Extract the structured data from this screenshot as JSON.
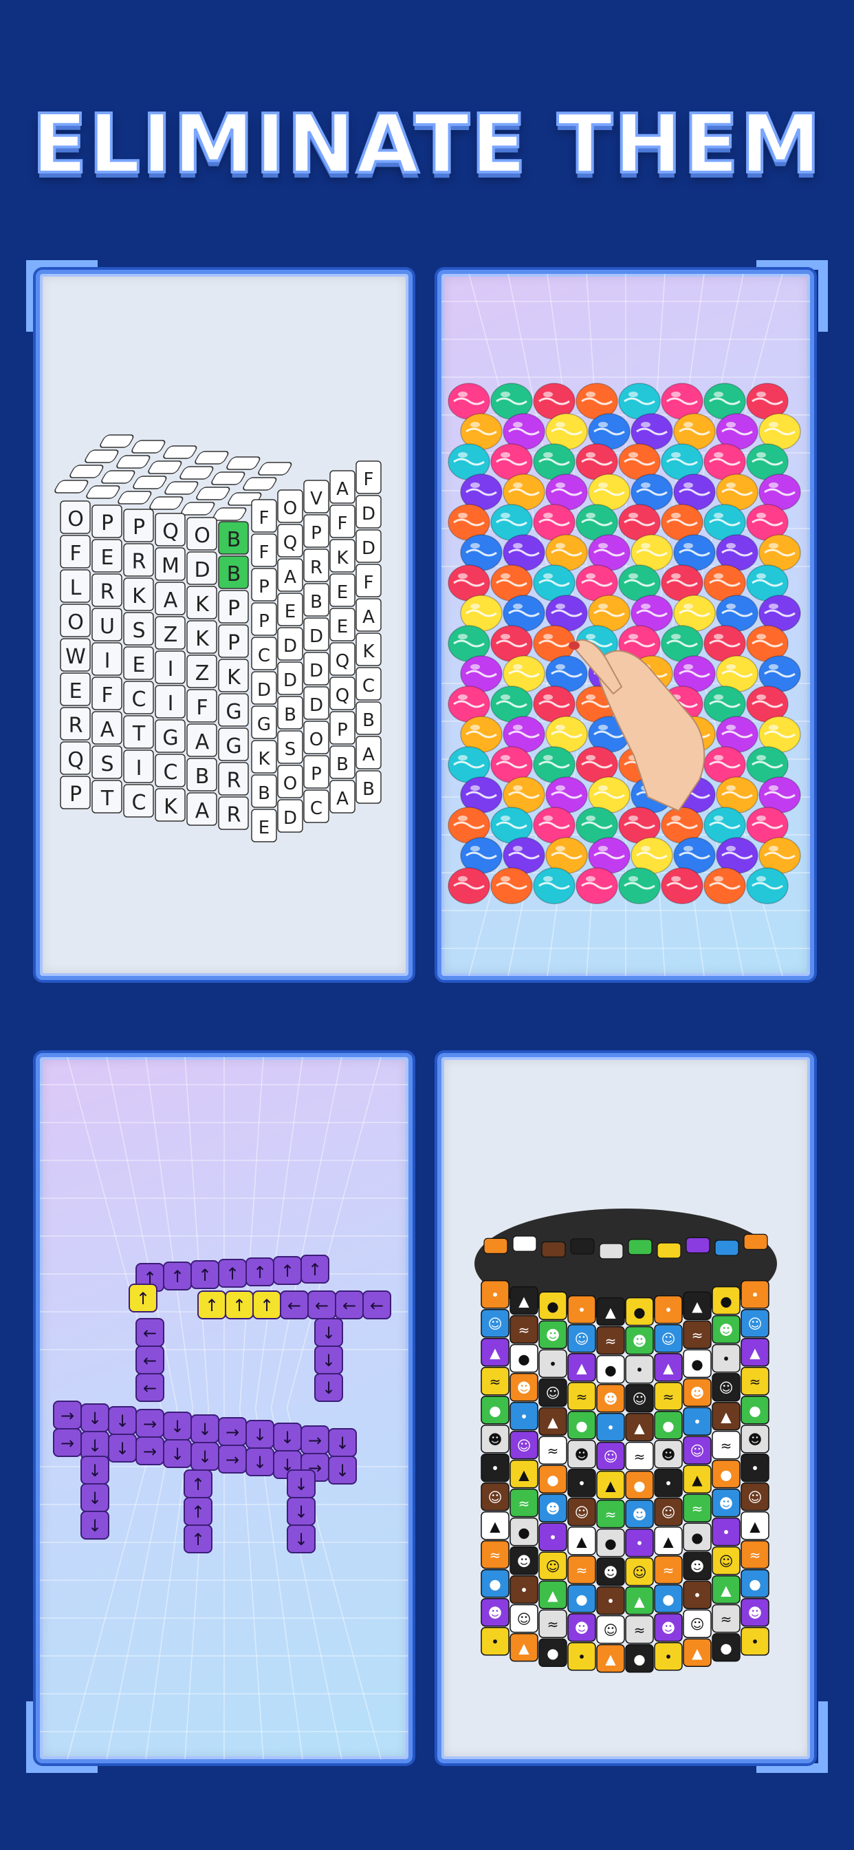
{
  "title": "ELIMINATE THEM",
  "colors": {
    "background": "#0f2f80",
    "panel_border": "#5a8df0",
    "letter_highlight": "#3cc85a",
    "block_purple": "#8a4fd8",
    "arrow_yellow": "#f5e22a"
  },
  "panels": [
    {
      "id": "letter-cube",
      "icon": "letter-cube-puzzle",
      "front_rows": [
        [
          "O",
          "P",
          "P",
          "Q",
          "O",
          "B"
        ],
        [
          "F",
          "E",
          "R",
          "M",
          "D",
          "B"
        ],
        [
          "L",
          "R",
          "K",
          "A",
          "K",
          "P"
        ],
        [
          "O",
          "U",
          "S",
          "Z",
          "K",
          "P"
        ],
        [
          "W",
          "I",
          "E",
          "I",
          "Z",
          "K"
        ],
        [
          "E",
          "F",
          "C",
          "I",
          "F",
          "G"
        ],
        [
          "R",
          "A",
          "T",
          "G",
          "A",
          "G"
        ],
        [
          "Q",
          "S",
          "I",
          "C",
          "B",
          "R"
        ],
        [
          "P",
          "T",
          "C",
          "K",
          "A",
          "R"
        ]
      ],
      "side_rows": [
        [
          "F",
          "O",
          "V",
          "A",
          "F"
        ],
        [
          "F",
          "Q",
          "P",
          "F",
          "D"
        ],
        [
          "P",
          "A",
          "R",
          "K",
          "D"
        ],
        [
          "P",
          "E",
          "B",
          "E",
          "F"
        ],
        [
          "C",
          "D",
          "D",
          "E",
          "A"
        ],
        [
          "D",
          "D",
          "D",
          "Q",
          "K"
        ],
        [
          "G",
          "B",
          "D",
          "Q",
          "C"
        ],
        [
          "K",
          "S",
          "O",
          "P",
          "B"
        ],
        [
          "B",
          "O",
          "P",
          "B",
          "A"
        ],
        [
          "E",
          "D",
          "C",
          "A",
          "B"
        ]
      ],
      "highlighted": [
        "B",
        "B"
      ]
    },
    {
      "id": "balloon-tower",
      "icon": "balloon-tower-with-hand"
    },
    {
      "id": "arrow-truck",
      "icon": "purple-arrow-cube-truck"
    },
    {
      "id": "halloween-cylinder",
      "icon": "halloween-tile-cylinder"
    }
  ]
}
